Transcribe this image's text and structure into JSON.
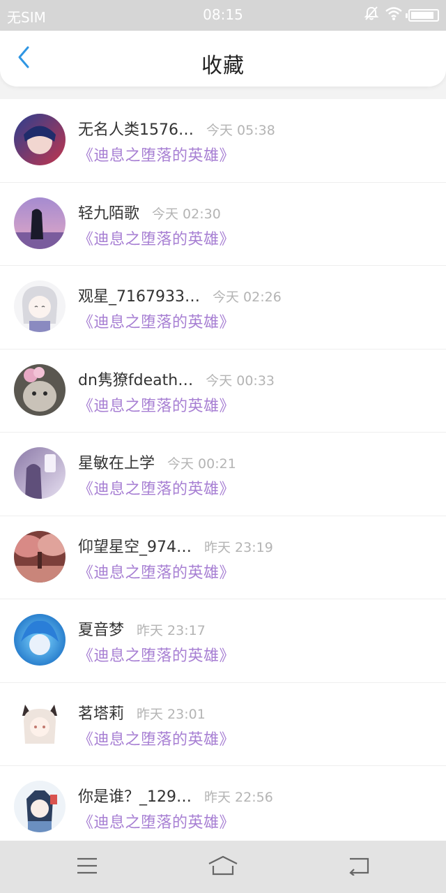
{
  "status_bar": {
    "carrier": "无SIM",
    "time": "08:15",
    "icons": [
      "mute-icon",
      "wifi-icon",
      "battery-icon"
    ],
    "battery_level": 0.9
  },
  "header": {
    "back_icon": "chevron-left-icon",
    "title": "收藏"
  },
  "colors": {
    "accent": "#2f96e3",
    "book_title": "#a77fd3",
    "status_bar_bg": "#d6d6d6",
    "nav_bar_bg": "#e3e3e3"
  },
  "favorites": [
    {
      "user": "无名人类1576…",
      "time": "今天 05:38",
      "book": "《迪息之堕落的英雄》"
    },
    {
      "user": "轻九陌歌",
      "time": "今天 02:30",
      "book": "《迪息之堕落的英雄》"
    },
    {
      "user": "观星_7167933…",
      "time": "今天 02:26",
      "book": "《迪息之堕落的英雄》"
    },
    {
      "user": "dn隽獠fdeath…",
      "time": "今天 00:33",
      "book": "《迪息之堕落的英雄》"
    },
    {
      "user": "星敏在上学",
      "time": "今天 00:21",
      "book": "《迪息之堕落的英雄》"
    },
    {
      "user": "仰望星空_974…",
      "time": "昨天 23:19",
      "book": "《迪息之堕落的英雄》"
    },
    {
      "user": "夏音梦",
      "time": "昨天 23:17",
      "book": "《迪息之堕落的英雄》"
    },
    {
      "user": "茗塔莉",
      "time": "昨天 23:01",
      "book": "《迪息之堕落的英雄》"
    },
    {
      "user": "你是谁？_129…",
      "time": "昨天 22:56",
      "book": "《迪息之堕落的英雄》"
    }
  ],
  "nav_bar": {
    "icons": [
      "menu-icon",
      "home-icon",
      "back-icon"
    ]
  }
}
